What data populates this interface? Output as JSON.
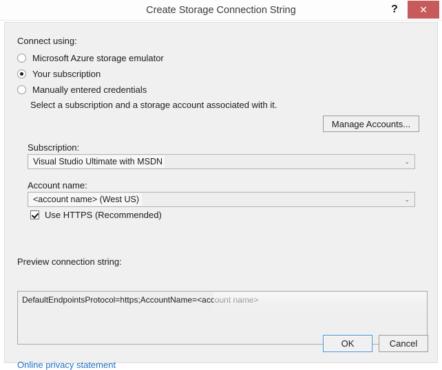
{
  "window": {
    "title": "Create Storage Connection String",
    "help_icon": "question-mark-icon",
    "help_label": "?",
    "close_icon": "close-icon",
    "close_label": "✕",
    "close_color": "#c75b5b"
  },
  "connect_using": {
    "label": "Connect using:",
    "options": [
      {
        "label": "Microsoft Azure storage emulator",
        "selected": false
      },
      {
        "label": "Your subscription",
        "selected": true
      },
      {
        "label": "Manually entered credentials",
        "selected": false
      }
    ],
    "description": "Select a subscription and a storage account associated with it."
  },
  "manage_accounts": {
    "label": "Manage Accounts..."
  },
  "subscription": {
    "label": "Subscription:",
    "value": "Visual Studio Ultimate with MSDN",
    "arrow_icon": "chevron-down-icon",
    "arrow_glyph": "⌄"
  },
  "account_name": {
    "label": "Account name:",
    "value": "<account name> (West US)",
    "arrow_icon": "chevron-down-icon",
    "arrow_glyph": "⌄"
  },
  "use_https": {
    "label": "Use HTTPS (Recommended)",
    "checked": true
  },
  "preview": {
    "label": "Preview connection string:",
    "value": "DefaultEndpointsProtocol=https;AccountName=<account name>"
  },
  "footer": {
    "privacy_link": "Online privacy statement",
    "ok_label": "OK",
    "cancel_label": "Cancel",
    "focus_color": "#3c91d8",
    "link_color": "#1f6fc4"
  }
}
